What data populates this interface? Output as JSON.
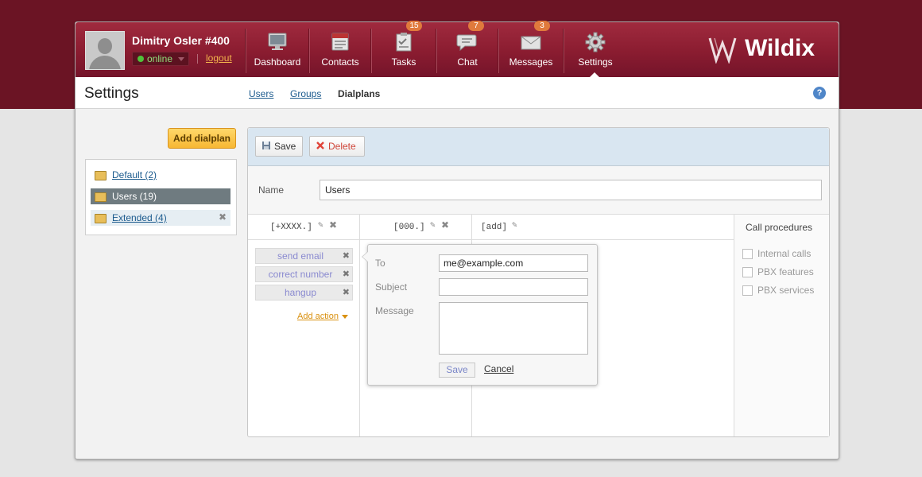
{
  "user": {
    "name": "Dimitry Osler #400",
    "status": "online",
    "logout": "logout"
  },
  "nav": [
    {
      "label": "Dashboard",
      "icon": "monitor-icon"
    },
    {
      "label": "Contacts",
      "icon": "contacts-icon"
    },
    {
      "label": "Tasks",
      "icon": "tasks-icon",
      "badge": "15"
    },
    {
      "label": "Chat",
      "icon": "chat-icon",
      "badge": "7"
    },
    {
      "label": "Messages",
      "icon": "envelope-icon",
      "badge": "3"
    },
    {
      "label": "Settings",
      "icon": "gear-icon",
      "active": true
    }
  ],
  "logo": "Wildix",
  "page": {
    "title": "Settings",
    "help": "?"
  },
  "tabs": [
    {
      "label": "Users"
    },
    {
      "label": "Groups"
    },
    {
      "label": "Dialplans",
      "active": true
    }
  ],
  "sidebar": {
    "add_button": "Add dialplan",
    "items": [
      {
        "label": "Default (2)"
      },
      {
        "label": "Users (19)",
        "selected": true
      },
      {
        "label": "Extended (4)"
      }
    ]
  },
  "toolbar": {
    "save": "Save",
    "delete": "Delete"
  },
  "name_field": {
    "label": "Name",
    "value": "Users"
  },
  "columns": [
    {
      "label": "[+XXXX.]"
    },
    {
      "label": "[000.]"
    },
    {
      "label": "[add]"
    }
  ],
  "actions": [
    "send email",
    "correct number",
    "hangup"
  ],
  "add_action": "Add action",
  "call_procedures": {
    "title": "Call procedures",
    "items": [
      "Internal calls",
      "PBX features",
      "PBX services"
    ]
  },
  "email_popup": {
    "to_label": "To",
    "to_value": "me@example.com",
    "subject_label": "Subject",
    "subject_value": "",
    "message_label": "Message",
    "message_value": "",
    "save": "Save",
    "cancel": "Cancel"
  },
  "colors": {
    "brand": "#8a1c30",
    "accent": "#f7b733",
    "link": "#1c5b8e"
  }
}
